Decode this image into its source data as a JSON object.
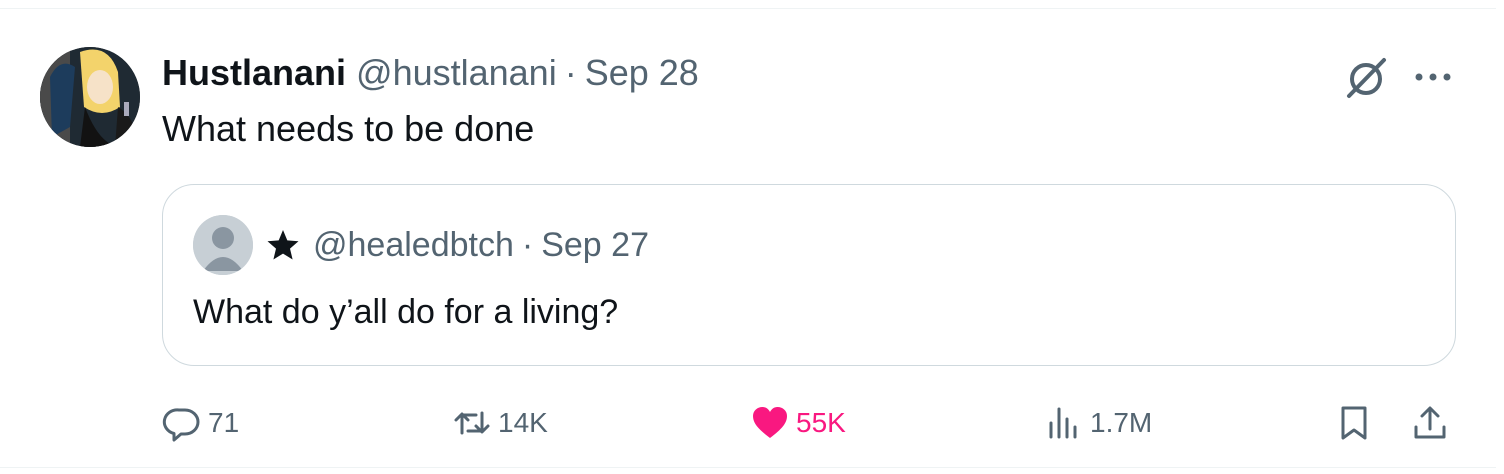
{
  "tweet": {
    "author_name": "Hustlanani",
    "author_handle": "@hustlanani",
    "separator": "·",
    "date": "Sep 28",
    "text": "What needs to be done"
  },
  "quoted_tweet": {
    "author_handle": "@healedbtch",
    "separator": "·",
    "date": "Sep 27",
    "text": "What do y’all do for a living?"
  },
  "actions": {
    "replies": "71",
    "reposts": "14K",
    "likes": "55K",
    "views": "1.7M"
  },
  "icons": {
    "grok": "grok-icon",
    "more": "more-icon",
    "reply": "reply-icon",
    "repost": "repost-icon",
    "like": "heart-icon",
    "views": "views-icon",
    "bookmark": "bookmark-icon",
    "share": "share-icon",
    "star": "star-icon"
  },
  "colors": {
    "text_primary": "#0f1419",
    "text_secondary": "#536471",
    "like_active": "#f91880",
    "border": "#cfd9de"
  }
}
